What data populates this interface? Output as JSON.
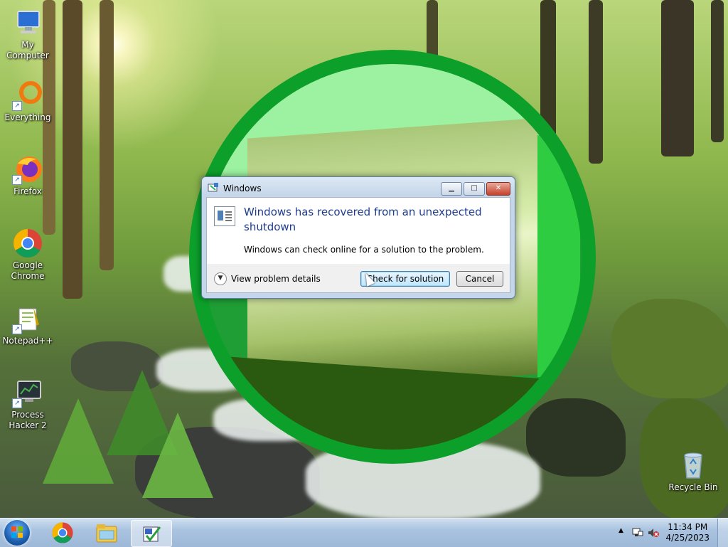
{
  "desktop": {
    "icons": [
      {
        "label": "My Computer",
        "icon": "computer-icon"
      },
      {
        "label": "Everything",
        "icon": "everything-icon"
      },
      {
        "label": "Firefox",
        "icon": "firefox-icon"
      },
      {
        "label": "Google Chrome",
        "icon": "chrome-icon"
      },
      {
        "label": "Notepad++",
        "icon": "notepadpp-icon"
      },
      {
        "label": "Process Hacker 2",
        "icon": "process-hacker-icon"
      },
      {
        "label": "Recycle Bin",
        "icon": "recycle-bin-icon"
      }
    ]
  },
  "dialog": {
    "title": "Windows",
    "headline": "Windows has recovered from an unexpected shutdown",
    "message": "Windows can check online for a solution to the problem.",
    "details_label": "View problem details",
    "primary_button": "Check for solution",
    "cancel_button": "Cancel",
    "minimize_glyph": "▁",
    "maximize_glyph": "□",
    "close_glyph": "✕"
  },
  "taskbar": {
    "pinned": [
      "chrome-icon",
      "explorer-icon",
      "report-problem-icon"
    ],
    "tray": {
      "time": "11:34 PM",
      "date": "4/25/2023",
      "show_hidden_glyph": "▲"
    }
  },
  "colors": {
    "headline": "#1e3d8f",
    "logo_green": "#0ca02a",
    "taskbar": "#a9c3e0"
  }
}
